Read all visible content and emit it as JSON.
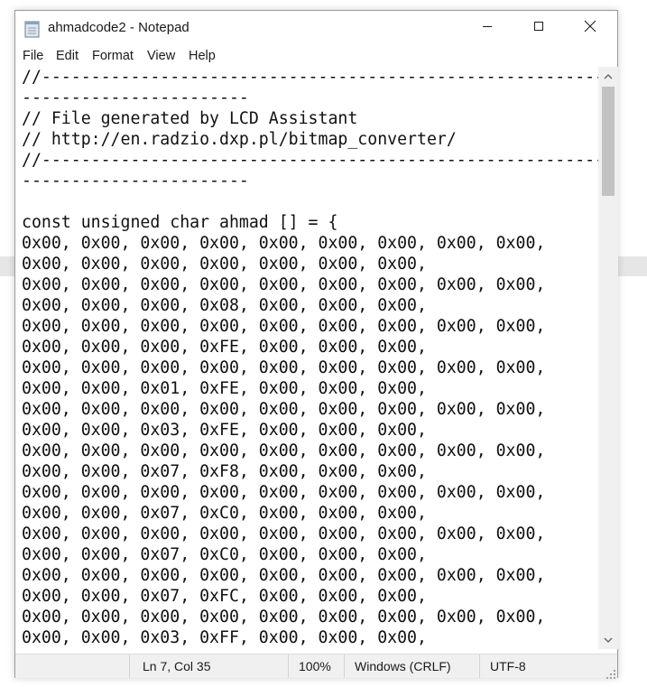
{
  "window": {
    "title": "ahmadcode2 - Notepad",
    "app_icon": "notepad-icon",
    "controls": [
      "minimize-icon",
      "maximize-icon",
      "close-icon"
    ]
  },
  "menu": {
    "items": [
      {
        "label": "File"
      },
      {
        "label": "Edit"
      },
      {
        "label": "Format"
      },
      {
        "label": "View"
      },
      {
        "label": "Help"
      }
    ]
  },
  "editor": {
    "lines": [
      "//------------------------------------------------------------",
      "-----------------------",
      "// File generated by LCD Assistant",
      "// http://en.radzio.dxp.pl/bitmap_converter/",
      "//------------------------------------------------------------",
      "-----------------------",
      "",
      "const unsigned char ahmad [] = {",
      "0x00, 0x00, 0x00, 0x00, 0x00, 0x00, 0x00, 0x00, 0x00,",
      "0x00, 0x00, 0x00, 0x00, 0x00, 0x00, 0x00,",
      "0x00, 0x00, 0x00, 0x00, 0x00, 0x00, 0x00, 0x00, 0x00,",
      "0x00, 0x00, 0x00, 0x08, 0x00, 0x00, 0x00,",
      "0x00, 0x00, 0x00, 0x00, 0x00, 0x00, 0x00, 0x00, 0x00,",
      "0x00, 0x00, 0x00, 0xFE, 0x00, 0x00, 0x00,",
      "0x00, 0x00, 0x00, 0x00, 0x00, 0x00, 0x00, 0x00, 0x00,",
      "0x00, 0x00, 0x01, 0xFE, 0x00, 0x00, 0x00,",
      "0x00, 0x00, 0x00, 0x00, 0x00, 0x00, 0x00, 0x00, 0x00,",
      "0x00, 0x00, 0x03, 0xFE, 0x00, 0x00, 0x00,",
      "0x00, 0x00, 0x00, 0x00, 0x00, 0x00, 0x00, 0x00, 0x00,",
      "0x00, 0x00, 0x07, 0xF8, 0x00, 0x00, 0x00,",
      "0x00, 0x00, 0x00, 0x00, 0x00, 0x00, 0x00, 0x00, 0x00,",
      "0x00, 0x00, 0x07, 0xC0, 0x00, 0x00, 0x00,",
      "0x00, 0x00, 0x00, 0x00, 0x00, 0x00, 0x00, 0x00, 0x00,",
      "0x00, 0x00, 0x07, 0xC0, 0x00, 0x00, 0x00,",
      "0x00, 0x00, 0x00, 0x00, 0x00, 0x00, 0x00, 0x00, 0x00,",
      "0x00, 0x00, 0x07, 0xFC, 0x00, 0x00, 0x00,",
      "0x00, 0x00, 0x00, 0x00, 0x00, 0x00, 0x00, 0x00, 0x00,",
      "0x00, 0x00, 0x03, 0xFF, 0x00, 0x00, 0x00,"
    ]
  },
  "status": {
    "position": "Ln 7, Col 35",
    "zoom": "100%",
    "line_ending": "Windows (CRLF)",
    "encoding": "UTF-8"
  },
  "scrollbar": {
    "up_icon": "chevron-up-icon",
    "down_icon": "chevron-down-icon"
  }
}
